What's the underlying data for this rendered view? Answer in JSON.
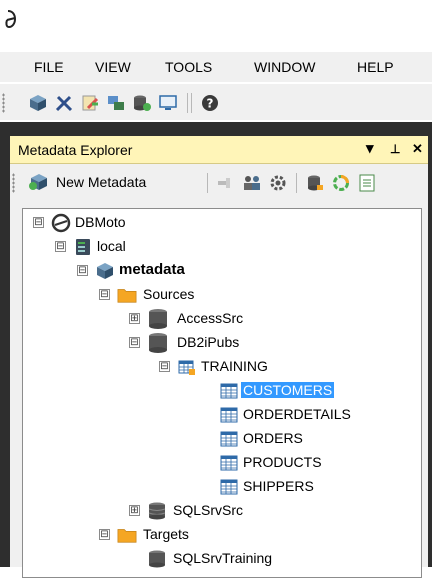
{
  "menubar": {
    "items": [
      {
        "label": "FILE"
      },
      {
        "label": "VIEW"
      },
      {
        "label": "TOOLS"
      },
      {
        "label": "WINDOW"
      },
      {
        "label": "HELP"
      }
    ]
  },
  "toolbar": {
    "icons": [
      "cube-icon",
      "tools-icon",
      "edit-icon",
      "copy-icon",
      "database-add-icon",
      "monitor-icon",
      "help-icon"
    ]
  },
  "panel": {
    "title": "Metadata Explorer",
    "dropdown_glyph": "▾",
    "pin_glyph": "⊥",
    "close_glyph": "✕",
    "new_metadata_label": "New Metadata"
  },
  "tree": {
    "nodes": [
      {
        "label": "DBMoto",
        "expander": "⊟"
      },
      {
        "label": "local",
        "expander": "⊟"
      },
      {
        "label": "metadata",
        "expander": "⊟"
      },
      {
        "label": "Sources",
        "expander": "⊟"
      },
      {
        "label": "AccessSrc",
        "expander": "⊞"
      },
      {
        "label": "DB2iPubs",
        "expander": "⊟"
      },
      {
        "label": "TRAINING",
        "expander": "⊟"
      },
      {
        "label": "CUSTOMERS",
        "selected": true
      },
      {
        "label": "ORDERDETAILS"
      },
      {
        "label": "ORDERS"
      },
      {
        "label": "PRODUCTS"
      },
      {
        "label": "SHIPPERS"
      },
      {
        "label": "SQLSrvSrc",
        "expander": "⊞"
      },
      {
        "label": "Targets",
        "expander": "⊟"
      },
      {
        "label": "SQLSrvTraining"
      }
    ]
  },
  "colors": {
    "selection": "#3399ff",
    "panel_header": "#fff5b8",
    "folder": "#f5a623",
    "frame": "#2e2e2e"
  }
}
